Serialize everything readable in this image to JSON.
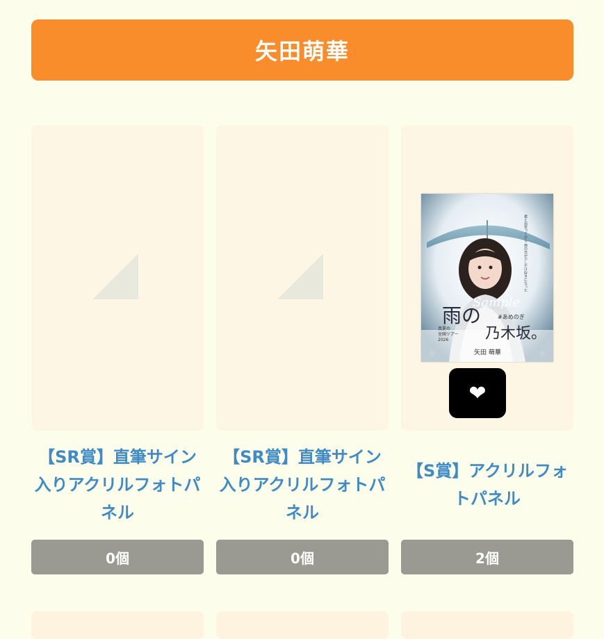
{
  "header": {
    "title": "矢田萌華"
  },
  "items": [
    {
      "title": "【SR賞】直筆サイン入りアクリルフォトパネル",
      "count": "0個"
    },
    {
      "title": "【SR賞】直筆サイン入りアクリルフォトパネル",
      "count": "0個"
    },
    {
      "title": "【S賞】アクリルフォトパネル",
      "count": "2個",
      "photo": {
        "text_main": "雨の",
        "text_sample": "Sample",
        "text_sub": "#あめのぎ",
        "text_brand": "乃木坂。",
        "text_tour1": "真夏の",
        "text_tour2": "全国ツアー",
        "text_year": "2026",
        "text_name": "矢田 萌華",
        "text_poem": "君と出会ってから 雨の日が少しだけ好きになった"
      },
      "favorite_icon": "heart-icon"
    }
  ],
  "colors": {
    "page_bg": "#fdfdeb",
    "header_bg": "#f98c2b",
    "card_bg": "#fef6e4",
    "title_text": "#3e8bc5",
    "count_bg": "#9a9a92",
    "favorite_bg": "#000000"
  }
}
